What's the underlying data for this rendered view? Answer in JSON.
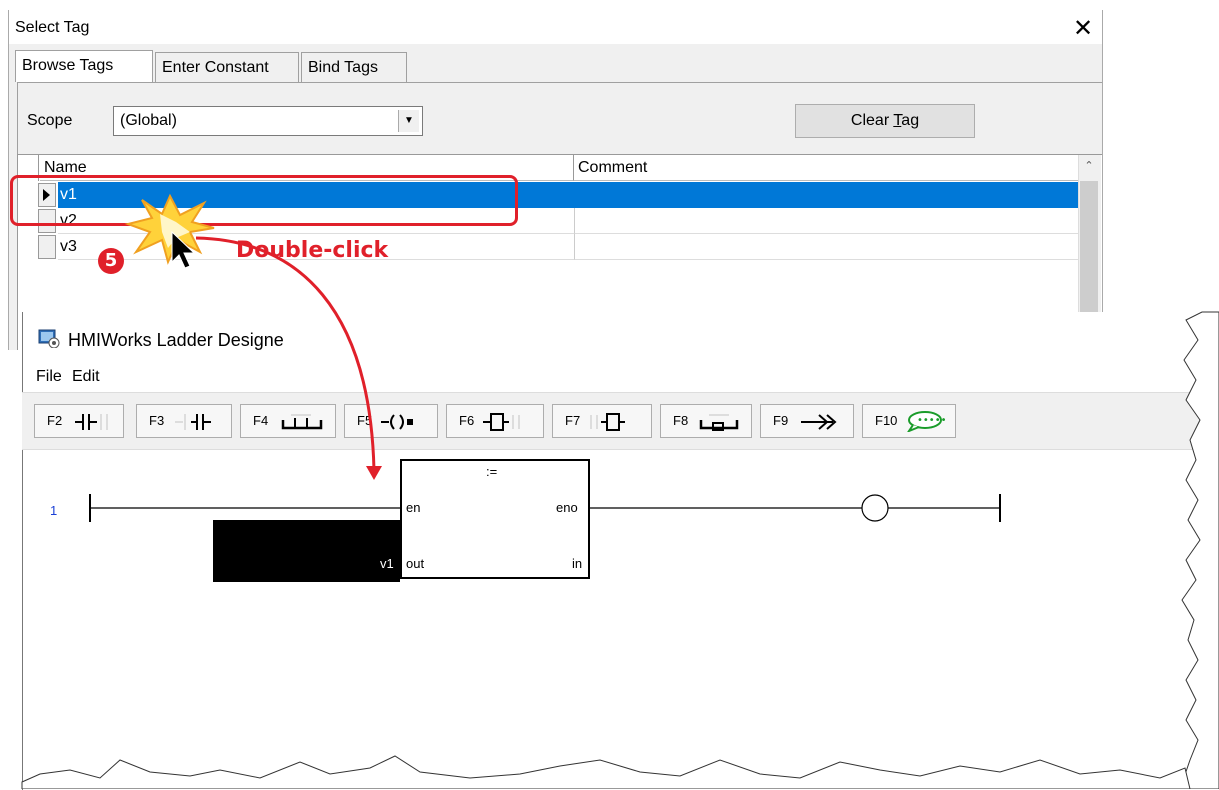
{
  "dialog": {
    "title": "Select Tag",
    "close_glyph": "✕",
    "tabs": [
      {
        "label": "Browse Tags",
        "active": true
      },
      {
        "label": "Enter Constant",
        "active": false
      },
      {
        "label": "Bind Tags",
        "active": false
      }
    ],
    "scope_label": "Scope",
    "scope_value": "(Global)",
    "clear_button_prefix": "Clear ",
    "clear_button_accel": "T",
    "clear_button_suffix": "ag",
    "columns": {
      "name": "Name",
      "comment": "Comment"
    },
    "rows": [
      {
        "name": "v1",
        "comment": "",
        "selected": true
      },
      {
        "name": "v2",
        "comment": "",
        "selected": false
      },
      {
        "name": "v3",
        "comment": "",
        "selected": false
      }
    ],
    "highlight_color": "#0078d7"
  },
  "annotation": {
    "step": "5",
    "label": "Double-click",
    "color": "#e0202a"
  },
  "ladder": {
    "title": "HMIWorks Ladder Designe",
    "menu": [
      "File",
      "Edit"
    ],
    "toolbar": [
      {
        "key": "F2",
        "icon": "no-contact-icon"
      },
      {
        "key": "F3",
        "icon": "nc-contact-icon"
      },
      {
        "key": "F4",
        "icon": "parallel-branch-icon"
      },
      {
        "key": "F5",
        "icon": "coil-icon"
      },
      {
        "key": "F6",
        "icon": "function-block-icon"
      },
      {
        "key": "F7",
        "icon": "function-block-parallel-icon"
      },
      {
        "key": "F8",
        "icon": "branch-down-icon"
      },
      {
        "key": "F9",
        "icon": "jump-arrow-icon"
      },
      {
        "key": "F10",
        "icon": "comment-bubble-icon"
      }
    ],
    "rung_number": "1",
    "block": {
      "operator": ":=",
      "pin_en": "en",
      "pin_eno": "eno",
      "pin_out": "out",
      "pin_in": "in",
      "bound_tag": "v1"
    }
  }
}
